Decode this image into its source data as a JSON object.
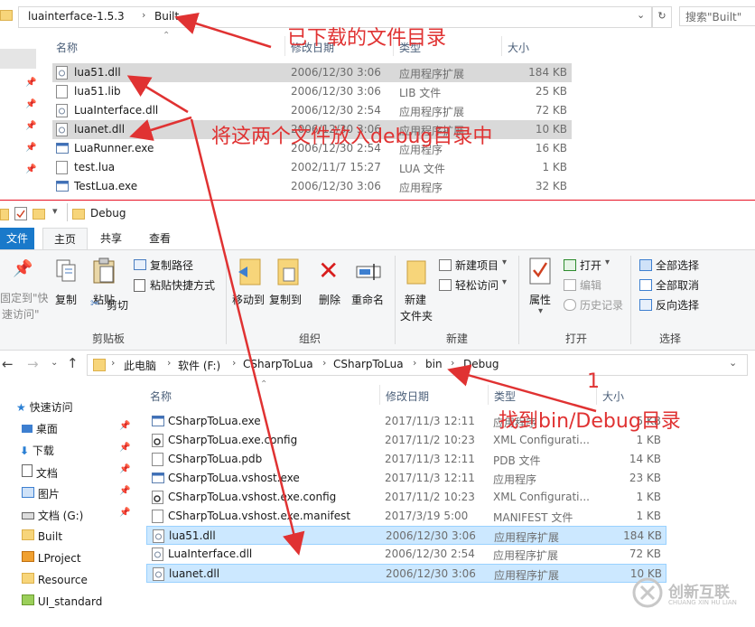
{
  "top_window": {
    "breadcrumb": [
      "luainterface-1.5.3",
      "Built"
    ],
    "search_placeholder": "搜索\"Built\"",
    "columns": [
      "名称",
      "修改日期",
      "类型",
      "大小"
    ],
    "files": [
      {
        "name": "lua51.dll",
        "date": "2006/12/30 3:06",
        "type": "应用程序扩展",
        "size": "184 KB",
        "icon": "dll-icon"
      },
      {
        "name": "lua51.lib",
        "date": "2006/12/30 3:06",
        "type": "LIB 文件",
        "size": "25 KB",
        "icon": "file-icon"
      },
      {
        "name": "LuaInterface.dll",
        "date": "2006/12/30 2:54",
        "type": "应用程序扩展",
        "size": "72 KB",
        "icon": "dll-icon"
      },
      {
        "name": "luanet.dll",
        "date": "2006/12/30 3:06",
        "type": "应用程序扩展",
        "size": "10 KB",
        "icon": "dll-icon"
      },
      {
        "name": "LuaRunner.exe",
        "date": "2006/12/30 2:54",
        "type": "应用程序",
        "size": "16 KB",
        "icon": "exe-icon"
      },
      {
        "name": "test.lua",
        "date": "2002/11/7 15:27",
        "type": "LUA 文件",
        "size": "1 KB",
        "icon": "file-icon"
      },
      {
        "name": "TestLua.exe",
        "date": "2006/12/30 3:06",
        "type": "应用程序",
        "size": "32 KB",
        "icon": "exe-icon"
      }
    ]
  },
  "bottom_window": {
    "title": "Debug",
    "tabs": [
      "文件",
      "主页",
      "共享",
      "查看"
    ],
    "ribbon": {
      "pin_label_1": "固定到\"快",
      "pin_label_2": "速访问\"",
      "copy": "复制",
      "paste": "粘贴",
      "copy_path": "复制路径",
      "paste_shortcut": "粘贴快捷方式",
      "cut": "剪切",
      "clipboard_group": "剪贴板",
      "move_to": "移动到",
      "copy_to": "复制到",
      "delete": "删除",
      "rename": "重命名",
      "organize_group": "组织",
      "new_folder_1": "新建",
      "new_folder_2": "文件夹",
      "new_item": "新建项目",
      "easy_access": "轻松访问",
      "new_group": "新建",
      "properties": "属性",
      "open": "打开",
      "edit": "编辑",
      "history": "历史记录",
      "open_group": "打开",
      "select_all": "全部选择",
      "select_none": "全部取消",
      "invert_selection": "反向选择",
      "select_group": "选择"
    },
    "breadcrumb": [
      "此电脑",
      "软件 (F:)",
      "CSharpToLua",
      "CSharpToLua",
      "bin",
      "Debug"
    ],
    "columns": [
      "名称",
      "修改日期",
      "类型",
      "大小"
    ],
    "sidebar": [
      {
        "label": "快速访问",
        "icon": "star-icon"
      },
      {
        "label": "桌面",
        "icon": "desktop-icon"
      },
      {
        "label": "下载",
        "icon": "download-icon"
      },
      {
        "label": "文档",
        "icon": "document-icon"
      },
      {
        "label": "图片",
        "icon": "picture-icon"
      },
      {
        "label": "文档 (G:)",
        "icon": "drive-icon"
      },
      {
        "label": "Built",
        "icon": "folder-icon"
      },
      {
        "label": "LProject",
        "icon": "folder-icon"
      },
      {
        "label": "Resource",
        "icon": "folder-icon"
      },
      {
        "label": "UI_standard",
        "icon": "folder-icon"
      }
    ],
    "files": [
      {
        "name": "CSharpToLua.exe",
        "date": "2017/11/3 12:11",
        "type": "应用程序",
        "size": "5 KB"
      },
      {
        "name": "CSharpToLua.exe.config",
        "date": "2017/11/2 10:23",
        "type": "XML Configurati...",
        "size": "1 KB"
      },
      {
        "name": "CSharpToLua.pdb",
        "date": "2017/11/3 12:11",
        "type": "PDB 文件",
        "size": "14 KB"
      },
      {
        "name": "CSharpToLua.vshost.exe",
        "date": "2017/11/3 12:11",
        "type": "应用程序",
        "size": "23 KB"
      },
      {
        "name": "CSharpToLua.vshost.exe.config",
        "date": "2017/11/2 10:23",
        "type": "XML Configurati...",
        "size": "1 KB"
      },
      {
        "name": "CSharpToLua.vshost.exe.manifest",
        "date": "2017/3/19 5:00",
        "type": "MANIFEST 文件",
        "size": "1 KB"
      },
      {
        "name": "lua51.dll",
        "date": "2006/12/30 3:06",
        "type": "应用程序扩展",
        "size": "184 KB"
      },
      {
        "name": "LuaInterface.dll",
        "date": "2006/12/30 2:54",
        "type": "应用程序扩展",
        "size": "72 KB"
      },
      {
        "name": "luanet.dll",
        "date": "2006/12/30 3:06",
        "type": "应用程序扩展",
        "size": "10 KB"
      }
    ]
  },
  "annotations": {
    "downloaded_dir": "已下载的文件目录",
    "put_into_debug": "将这两个文件放入debug目录中",
    "step_number": "1",
    "find_bin_debug": "找到bin/Debug目录"
  },
  "watermark": {
    "text": "创新互联",
    "subtext": "CHUANG XIN HU LIAN"
  },
  "colors": {
    "annotation": "#e03232",
    "selection_blue": "#cce8ff",
    "file_tab": "#1979ca"
  }
}
